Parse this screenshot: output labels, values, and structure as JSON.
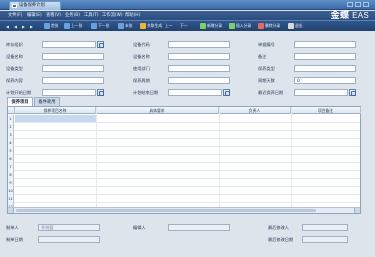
{
  "titlebar": {
    "tab_title": "设备保养计划"
  },
  "menu": [
    "文件(F)",
    "编辑(E)",
    "查看(V)",
    "业务(B)",
    "工具(T)",
    "工作流(W)",
    "帮助(H)"
  ],
  "toolbar": {
    "nav": [
      "◀",
      "◀",
      "▶",
      "▶"
    ],
    "buttons": [
      {
        "label": "首张",
        "icon": "first-icon"
      },
      {
        "label": "上一张",
        "icon": "prev-icon"
      },
      {
        "label": "下一张",
        "icon": "next-icon"
      },
      {
        "label": "末张",
        "icon": "last-icon"
      },
      {
        "label": "关联生成",
        "icon": "link-generate-icon"
      },
      {
        "label": "新增分录",
        "icon": "add-entry-icon"
      },
      {
        "label": "插入分录",
        "icon": "insert-entry-icon"
      },
      {
        "label": "删除分录",
        "icon": "delete-entry-icon"
      },
      {
        "label": "退出",
        "icon": "exit-icon"
      }
    ],
    "pages": [
      "上一",
      "下一"
    ],
    "accent": "#2f568c"
  },
  "logo": {
    "brand": "金蝶",
    "suffix": "EAS"
  },
  "form": {
    "col1": [
      "库存组织",
      "设备名称",
      "设备类型",
      "保养内容",
      "计划开始日期"
    ],
    "col2": [
      "设备代码",
      "设备名称",
      "使用部门",
      "保养周期",
      "计划结束日期"
    ],
    "col3": [
      "单据编号",
      "备注",
      "保养类型",
      "周期天数",
      "最近保养日期"
    ],
    "cycle_days_value": "0"
  },
  "tabs": [
    "保养项目",
    "备件耗用"
  ],
  "grid": {
    "columns": [
      "保养项目名称",
      "具体要求",
      "负责人",
      "项目备注"
    ],
    "row_numbers": [
      "1",
      "2",
      "3",
      "4",
      "5",
      "6",
      "7",
      "8",
      "9",
      "10",
      "11",
      "12"
    ]
  },
  "footer": {
    "creator_label": "制单人",
    "creator_value": "系统管",
    "editor_label": "编辑人",
    "last_modifier_label": "最后修改人",
    "create_date_label": "制单日期",
    "last_modified_date_label": "最后修改日期"
  }
}
